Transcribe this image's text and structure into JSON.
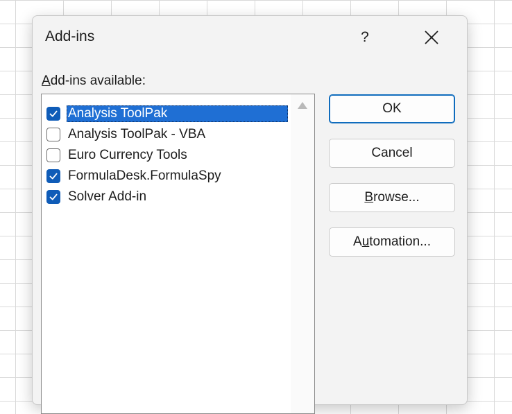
{
  "dialog": {
    "title": "Add-ins",
    "help_label": "?",
    "close_icon": "close-icon"
  },
  "list": {
    "label_accel": "A",
    "label_rest": "dd-ins available:",
    "items": [
      {
        "label": "Analysis ToolPak",
        "checked": true,
        "selected": true
      },
      {
        "label": "Analysis ToolPak - VBA",
        "checked": false,
        "selected": false
      },
      {
        "label": "Euro Currency Tools",
        "checked": false,
        "selected": false
      },
      {
        "label": "FormulaDesk.FormulaSpy",
        "checked": true,
        "selected": false
      },
      {
        "label": "Solver Add-in",
        "checked": true,
        "selected": false
      }
    ]
  },
  "buttons": {
    "ok": "OK",
    "cancel": "Cancel",
    "browse_accel": "B",
    "browse_rest": "rowse...",
    "automation_pre": "A",
    "automation_accel": "u",
    "automation_rest": "tomation..."
  },
  "colors": {
    "accent": "#0f5cb8",
    "selection": "#1f6fd4"
  }
}
